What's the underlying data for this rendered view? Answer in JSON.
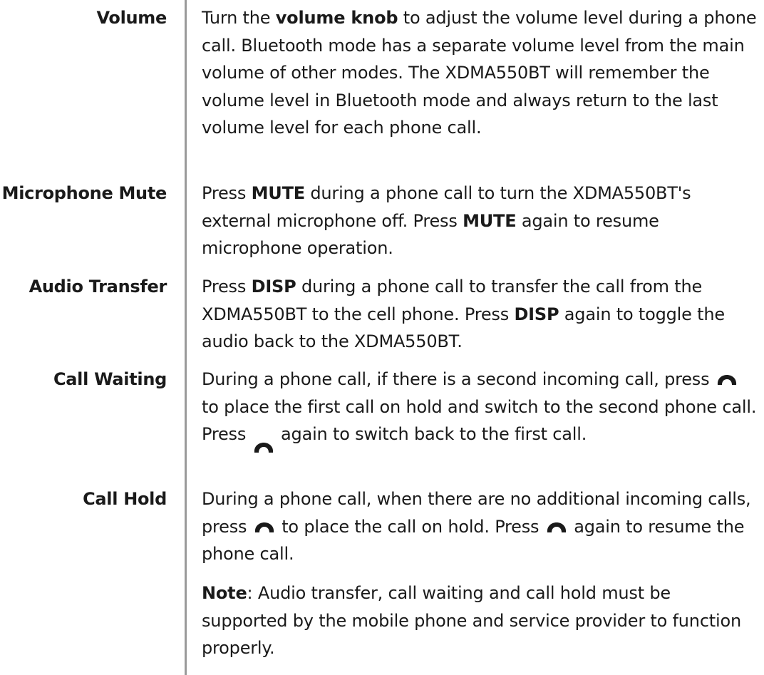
{
  "volume": {
    "term": "Volume",
    "s1": "Turn the ",
    "b1": "volume knob",
    "s2": " to adjust the volume level during a phone call. Bluetooth mode has a separate volume level from the main volume of other modes. The XDMA550BT will remember the volume level in Bluetooth mode and always return to the last volume level for each phone call."
  },
  "mute": {
    "term": "Microphone Mute",
    "s1": "Press ",
    "b1": "MUTE",
    "s2": " during a phone call to turn the XDMA550BT's external microphone off. Press ",
    "b2": "MUTE",
    "s3": " again to resume microphone operation."
  },
  "transfer": {
    "term": "Audio Transfer",
    "s1": "Press ",
    "b1": "DISP",
    "s2": " during a phone call to transfer the call from the XDMA550BT to the cell phone. Press ",
    "b2": "DISP",
    "s3": " again to toggle the audio back to the XDMA550BT."
  },
  "waiting": {
    "term": "Call Waiting",
    "s1": "During a phone call, if there is a second incoming call, press",
    "s2": " to place the first call on hold and switch to the second phone call. Press ",
    "s3": " again to switch back to the first call."
  },
  "hold": {
    "term": "Call Hold",
    "s1": "During a phone call, when there are no additional incoming calls, press ",
    "s2": " to place the call on hold. Press ",
    "s3": " again to resume the phone call."
  },
  "note": {
    "label": "Note",
    "text": ": Audio transfer, call waiting and call hold must be supported by the mobile phone and service provider to function properly."
  },
  "icons": {
    "phone": "phone-handset-icon"
  },
  "colors": {
    "text": "#1a1a1a",
    "divider": "#9a9a9a"
  }
}
